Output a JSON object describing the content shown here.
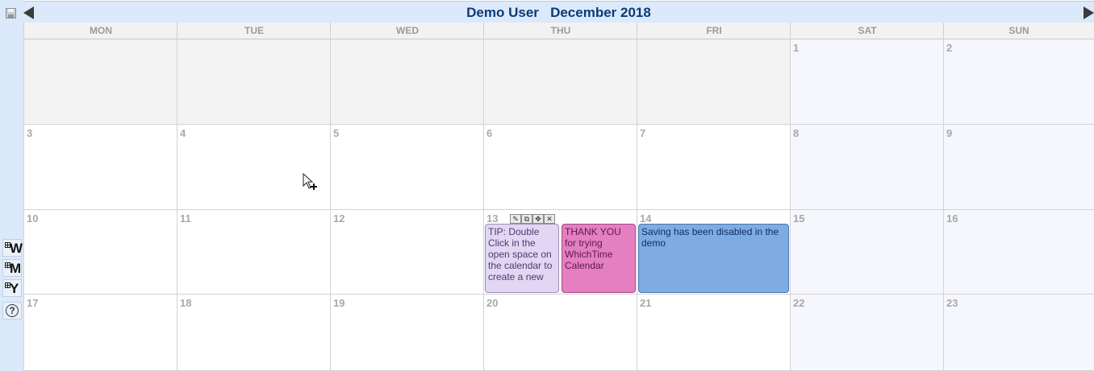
{
  "header": {
    "user": "Demo User",
    "month": "December 2018"
  },
  "day_headers": [
    "MON",
    "TUE",
    "WED",
    "THU",
    "FRI",
    "SAT",
    "SUN"
  ],
  "weeks": [
    [
      "",
      "",
      "",
      "",
      "",
      "1",
      "2"
    ],
    [
      "3",
      "4",
      "5",
      "6",
      "7",
      "8",
      "9"
    ],
    [
      "10",
      "11",
      "12",
      "13",
      "14",
      "15",
      "16"
    ],
    [
      "17",
      "18",
      "19",
      "20",
      "21",
      "22",
      "23"
    ]
  ],
  "events": {
    "tip": "TIP: Double Click in the open space on the calendar to create a new",
    "thanks": "THANK YOU for trying WhichTime Calendar",
    "saving": "Saving has been disabled in the demo"
  },
  "sidebar": {
    "week_view": "W",
    "month_view": "M",
    "year_view": "Y",
    "help": "?"
  },
  "event_toolbar": {
    "edit": "✎",
    "copy": "⧉",
    "move": "✥",
    "delete": "✕"
  },
  "colors": {
    "accent": "#0b3b78",
    "tip_event": "#e2d6f3",
    "thanks_event": "#e47fc1",
    "saving_event": "#7fabe3"
  }
}
